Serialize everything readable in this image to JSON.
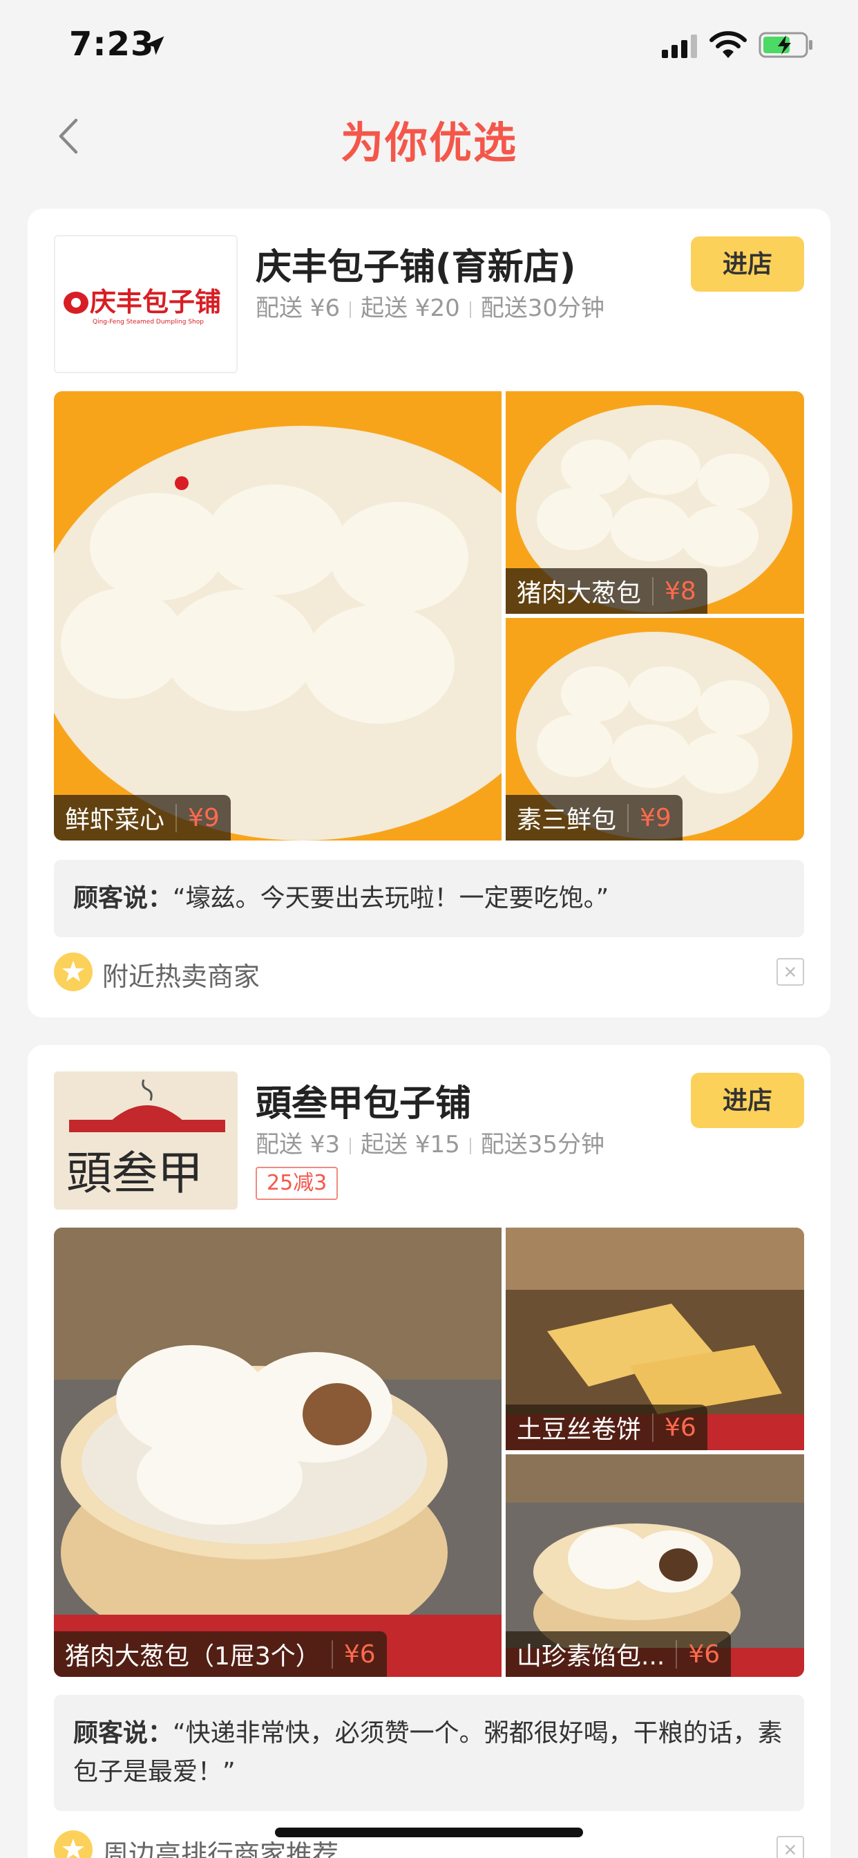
{
  "status_bar": {
    "time": "7:23"
  },
  "nav": {
    "title": "为你优选"
  },
  "shops": [
    {
      "name": "庆丰包子铺(育新店)",
      "meta": {
        "delivery_fee": "配送 ¥6",
        "min_order": "起送 ¥20",
        "delivery_time": "配送30分钟"
      },
      "enter_label": "进店",
      "logo_text": "庆丰包子铺",
      "logo_subtext": "Qing-Feng Steamed Dumpling Shop",
      "dishes": [
        {
          "name": "鲜虾菜心",
          "price": "¥9"
        },
        {
          "name": "猪肉大葱包",
          "price": "¥8"
        },
        {
          "name": "素三鲜包",
          "price": "¥9"
        }
      ],
      "review_label": "顾客说：",
      "review_text": "“壕兹。今天要出去玩啦！一定要吃饱。”",
      "recommendation": "附近热卖商家"
    },
    {
      "name": "頭叁甲包子铺",
      "meta": {
        "delivery_fee": "配送 ¥3",
        "min_order": "起送 ¥15",
        "delivery_time": "配送35分钟"
      },
      "enter_label": "进店",
      "logo_text": "頭叁甲",
      "promo": "25减3",
      "dishes": [
        {
          "name": "猪肉大葱包（1屉3个）",
          "price": "¥6"
        },
        {
          "name": "土豆丝卷饼",
          "price": "¥6"
        },
        {
          "name": "山珍素馅包...",
          "price": "¥6"
        }
      ],
      "review_label": "顾客说：",
      "review_text": "“快递非常快，必须赞一个。粥都很好喝，干粮的话，素包子是最爱！”",
      "recommendation": "周边高排行商家推荐"
    }
  ],
  "colors": {
    "accent": "#f4574a",
    "button": "#fcd15a",
    "price": "#ff6a4d",
    "photo_bg_1": "#f8a41a"
  }
}
